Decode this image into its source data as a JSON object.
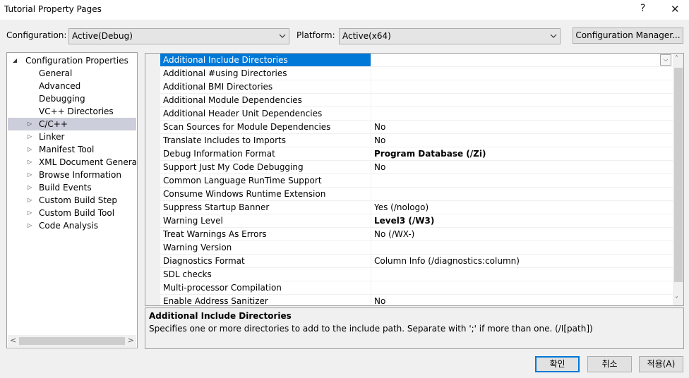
{
  "window": {
    "title": "Tutorial Property Pages",
    "help_glyph": "?",
    "close_glyph": "✕"
  },
  "toolbar": {
    "configuration_label": "Configuration:",
    "configuration_value": "Active(Debug)",
    "platform_label": "Platform:",
    "platform_value": "Active(x64)",
    "config_manager_label": "Configuration Manager..."
  },
  "tree": {
    "items": [
      {
        "label": "Configuration Properties",
        "expander": "◢"
      },
      {
        "label": "General",
        "expander": ""
      },
      {
        "label": "Advanced",
        "expander": ""
      },
      {
        "label": "Debugging",
        "expander": ""
      },
      {
        "label": "VC++ Directories",
        "expander": ""
      },
      {
        "label": "C/C++",
        "expander": "▷",
        "selected": true
      },
      {
        "label": "Linker",
        "expander": "▷"
      },
      {
        "label": "Manifest Tool",
        "expander": "▷"
      },
      {
        "label": "XML Document Generator",
        "expander": "▷"
      },
      {
        "label": "Browse Information",
        "expander": "▷"
      },
      {
        "label": "Build Events",
        "expander": "▷"
      },
      {
        "label": "Custom Build Step",
        "expander": "▷"
      },
      {
        "label": "Custom Build Tool",
        "expander": "▷"
      },
      {
        "label": "Code Analysis",
        "expander": "▷"
      }
    ],
    "scroll_left": "<",
    "scroll_right": ">"
  },
  "grid": {
    "dropdown_glyph": "⌵",
    "rows": [
      {
        "name": "Additional Include Directories",
        "value": ""
      },
      {
        "name": "Additional #using Directories",
        "value": ""
      },
      {
        "name": "Additional BMI Directories",
        "value": ""
      },
      {
        "name": "Additional Module Dependencies",
        "value": ""
      },
      {
        "name": "Additional Header Unit Dependencies",
        "value": ""
      },
      {
        "name": "Scan Sources for Module Dependencies",
        "value": "No"
      },
      {
        "name": "Translate Includes to Imports",
        "value": "No"
      },
      {
        "name": "Debug Information Format",
        "value": "Program Database (/Zi)",
        "bold": true
      },
      {
        "name": "Support Just My Code Debugging",
        "value": "No"
      },
      {
        "name": "Common Language RunTime Support",
        "value": ""
      },
      {
        "name": "Consume Windows Runtime Extension",
        "value": ""
      },
      {
        "name": "Suppress Startup Banner",
        "value": "Yes (/nologo)"
      },
      {
        "name": "Warning Level",
        "value": "Level3 (/W3)",
        "bold": true
      },
      {
        "name": "Treat Warnings As Errors",
        "value": "No (/WX-)"
      },
      {
        "name": "Warning Version",
        "value": ""
      },
      {
        "name": "Diagnostics Format",
        "value": "Column Info (/diagnostics:column)"
      },
      {
        "name": "SDL checks",
        "value": ""
      },
      {
        "name": "Multi-processor Compilation",
        "value": ""
      },
      {
        "name": "Enable Address Sanitizer",
        "value": "No"
      }
    ],
    "scroll_up": "˄",
    "scroll_down": "˅"
  },
  "description": {
    "title": "Additional Include Directories",
    "text": "Specifies one or more directories to add to the include path. Separate with ';' if more than one.      (/I[path])"
  },
  "buttons": {
    "ok": "확인",
    "cancel": "취소",
    "apply": "적용(A)"
  },
  "colors": {
    "selection": "#0078d7",
    "tree_selection": "#cccedb"
  }
}
